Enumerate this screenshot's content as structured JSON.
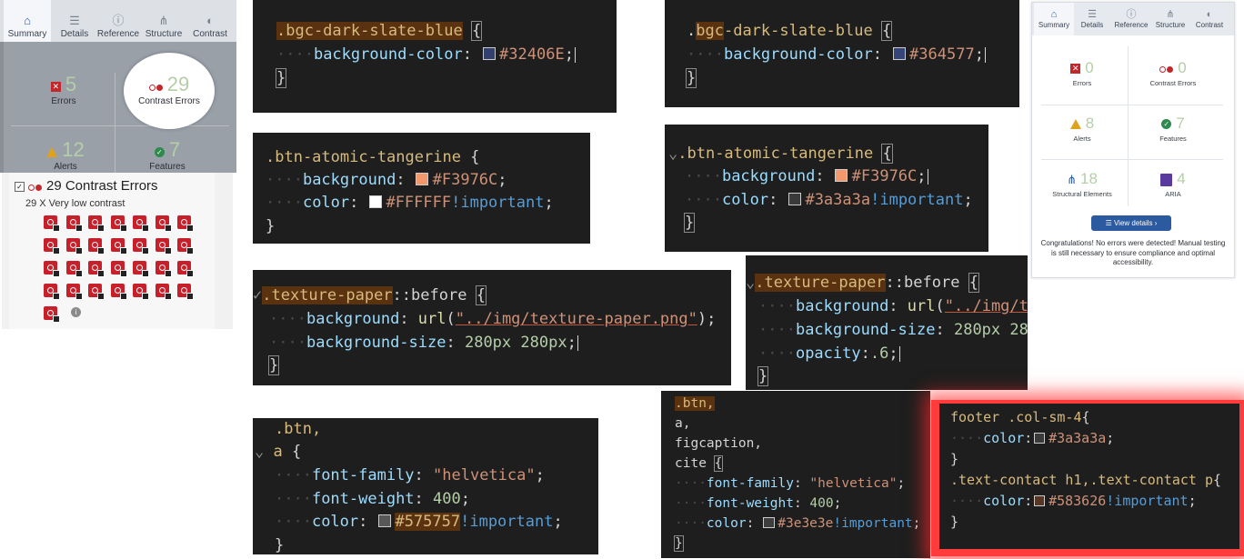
{
  "wave_left": {
    "tabs": [
      {
        "label": "Summary",
        "icon": "home-icon"
      },
      {
        "label": "Details",
        "icon": "list-icon"
      },
      {
        "label": "Reference",
        "icon": "info-icon"
      },
      {
        "label": "Structure",
        "icon": "hierarchy-icon"
      },
      {
        "label": "Contrast",
        "icon": "contrast-icon"
      }
    ],
    "errors": {
      "count": "5",
      "label": "Errors"
    },
    "contrast": {
      "count": "29",
      "label": "Contrast Errors"
    },
    "alerts": {
      "count": "12",
      "label": "Alerts"
    },
    "features": {
      "count": "7",
      "label": "Features"
    }
  },
  "contrast_list": {
    "heading": "29 Contrast Errors",
    "subheading": "29 X Very low contrast",
    "icon_count": 29
  },
  "wave_right": {
    "tabs": [
      {
        "label": "Summary",
        "icon": "home-icon"
      },
      {
        "label": "Details",
        "icon": "list-icon"
      },
      {
        "label": "Reference",
        "icon": "info-icon"
      },
      {
        "label": "Structure",
        "icon": "hierarchy-icon"
      },
      {
        "label": "Contrast",
        "icon": "contrast-icon"
      }
    ],
    "errors": {
      "count": "0",
      "label": "Errors"
    },
    "contrast": {
      "count": "0",
      "label": "Contrast Errors"
    },
    "alerts": {
      "count": "8",
      "label": "Alerts"
    },
    "features": {
      "count": "7",
      "label": "Features"
    },
    "structural": {
      "count": "18",
      "label": "Structural Elements"
    },
    "aria": {
      "count": "4",
      "label": "ARIA"
    },
    "view_details": "View details ›",
    "congrats": "Congratulations! No errors were detected! Manual testing is still necessary to ensure compliance and optimal accessibility."
  },
  "colors": {
    "code_bg": "#1e1e1e",
    "wave_blue": "#2c5aa0",
    "error_red": "#c3262b",
    "highlight_glow": "#ff3b3b"
  },
  "code": {
    "bgc1": {
      "selector": ".bgc-dark-slate-blue",
      "prop": "background-color",
      "value": "#32406E",
      "swatch": "#32406E"
    },
    "bgc2": {
      "selector": ".bgc-dark-slate-blue",
      "prop": "background-color",
      "value": "#364577",
      "swatch": "#364577"
    },
    "btn1": {
      "selector": ".btn-atomic-tangerine",
      "prop1": "background",
      "value1": "#F3976C",
      "swatch1": "#F3976C",
      "prop2": "color",
      "value2": "#FFFFFF",
      "swatch2": "#FFFFFF",
      "important": "!important"
    },
    "btn2": {
      "selector": ".btn-atomic-tangerine",
      "prop1": "background",
      "value1": "#F3976C",
      "swatch1": "#F3976C",
      "prop2": "color",
      "value2": "#3a3a3a",
      "swatch2": "#3a3a3a",
      "important": "!important"
    },
    "tex1": {
      "selector": ".texture-paper",
      "pseudo": "::before",
      "prop1": "background",
      "url_fn": "url",
      "url": "\"../img/texture-paper.png\"",
      "prop2": "background-size",
      "size": "280px 280px"
    },
    "tex2": {
      "selector": ".texture-paper",
      "pseudo": "::before",
      "prop1": "background",
      "url_fn": "url",
      "url": "\"../img/t",
      "prop2": "background-size",
      "size": "280px 28",
      "prop3": "opacity",
      "opacity": ".6"
    },
    "font1": {
      "sel1": ".btn,",
      "sel2": "a",
      "prop1": "font-family",
      "val1": "\"helvetica\"",
      "prop2": "font-weight",
      "val2": "400",
      "prop3": "color",
      "val3": "#575757",
      "swatch3": "#575757",
      "important": "!important"
    },
    "font2": {
      "sel1": ".btn,",
      "sel2": "a,",
      "sel3": "figcaption,",
      "sel4": "cite",
      "prop1": "font-family",
      "val1": "\"helvetica\"",
      "prop2": "font-weight",
      "val2": "400",
      "prop3": "color",
      "val3": "#3e3e3e",
      "swatch3": "#3e3e3e",
      "important": "!important"
    },
    "footer": {
      "sel1": "footer .col-sm-4",
      "prop1": "color",
      "val1": "#3a3a3a",
      "swatch1": "#3a3a3a",
      "sel2": ".text-contact h1,.text-contact p",
      "prop2": "color",
      "val2": "#583626",
      "swatch2": "#583626",
      "important": "!important"
    }
  }
}
